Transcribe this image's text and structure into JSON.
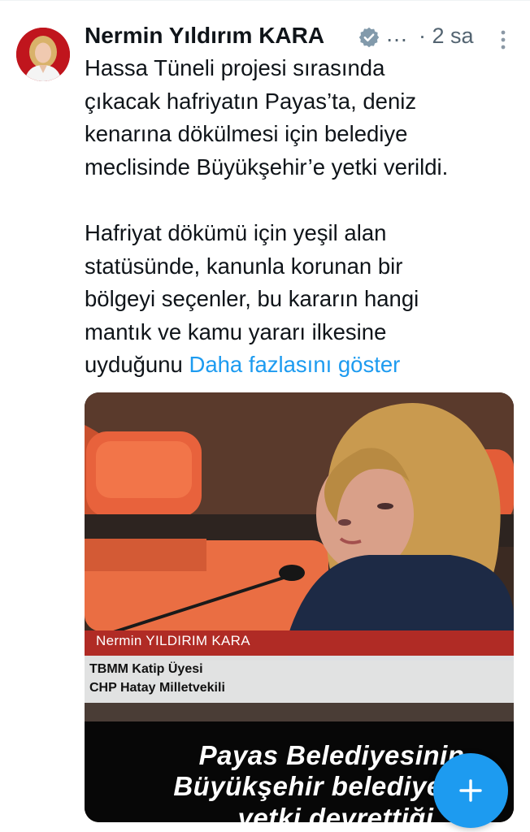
{
  "tweet": {
    "author_name": "Nermin Yıldırım KARA",
    "name_ellipsis": "…",
    "timestamp": "· 2 sa",
    "text_lines": [
      "Hassa Tüneli projesi sırasında",
      "çıkacak hafriyatın Payas’ta, deniz",
      "kenarına dökülmesi için belediye",
      "meclisinde Büyükşehir’e yetki verildi.",
      "",
      "Hafriyat dökümü için yeşil alan",
      "statüsünde, kanunla korunan bir",
      "bölgeyi seçenler, bu kararın hangi",
      "mantık ve kamu yararı ilkesine"
    ],
    "last_line_text": "uyduğunu ",
    "show_more": "Daha fazlasını göster"
  },
  "media": {
    "lower_third_name": "Nermin YILDIRIM KARA",
    "lower_third_role_1": "TBMM Katip Üyesi",
    "lower_third_role_2": "CHP Hatay Milletvekili",
    "caption_line_1": "Payas Belediyesinin",
    "caption_line_2": "Büyükşehir belediyes",
    "caption_line_3": "yetki devrettiği"
  },
  "icons": {
    "verified": "verified-badge-icon",
    "more": "more-vertical-icon",
    "compose": "plus-icon"
  },
  "colors": {
    "accent": "#1d9bf0",
    "secondary_text": "#536471",
    "lower_third_red": "#b02b25"
  }
}
